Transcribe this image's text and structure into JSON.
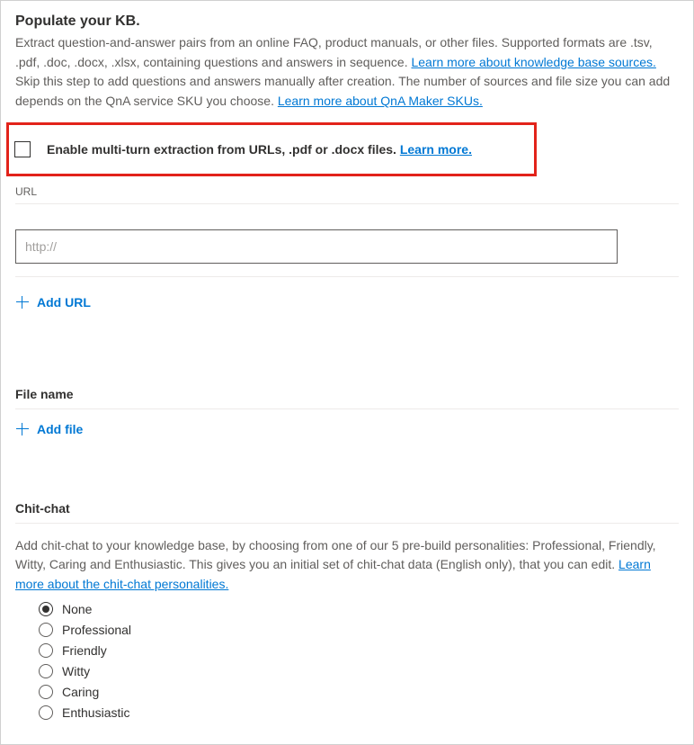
{
  "heading": "Populate your KB.",
  "desc_part1": "Extract question-and-answer pairs from an online FAQ, product manuals, or other files. Supported formats are .tsv, .pdf, .doc, .docx, .xlsx, containing questions and answers in sequence. ",
  "link_sources": "Learn more about knowledge base sources. ",
  "desc_part2": "Skip this step to add questions and answers manually after creation. The number of sources and file size you can add depends on the QnA service SKU you choose. ",
  "link_skus": "Learn more about QnA Maker SKUs.",
  "multiturn": {
    "label": "Enable multi-turn extraction from URLs, .pdf or .docx files. ",
    "link": "Learn more."
  },
  "url": {
    "label": "URL",
    "placeholder": "http://",
    "value": "",
    "add_label": "Add URL"
  },
  "file": {
    "label": "File name",
    "add_label": "Add file"
  },
  "chitchat": {
    "heading": "Chit-chat",
    "desc": "Add chit-chat to your knowledge base, by choosing from one of our 5 pre-build personalities: Professional, Friendly, Witty, Caring and Enthusiastic. This gives you an initial set of chit-chat data (English only), that you can edit. ",
    "link": "Learn more about the chit-chat personalities.",
    "selected": "None",
    "options": [
      "None",
      "Professional",
      "Friendly",
      "Witty",
      "Caring",
      "Enthusiastic"
    ]
  }
}
